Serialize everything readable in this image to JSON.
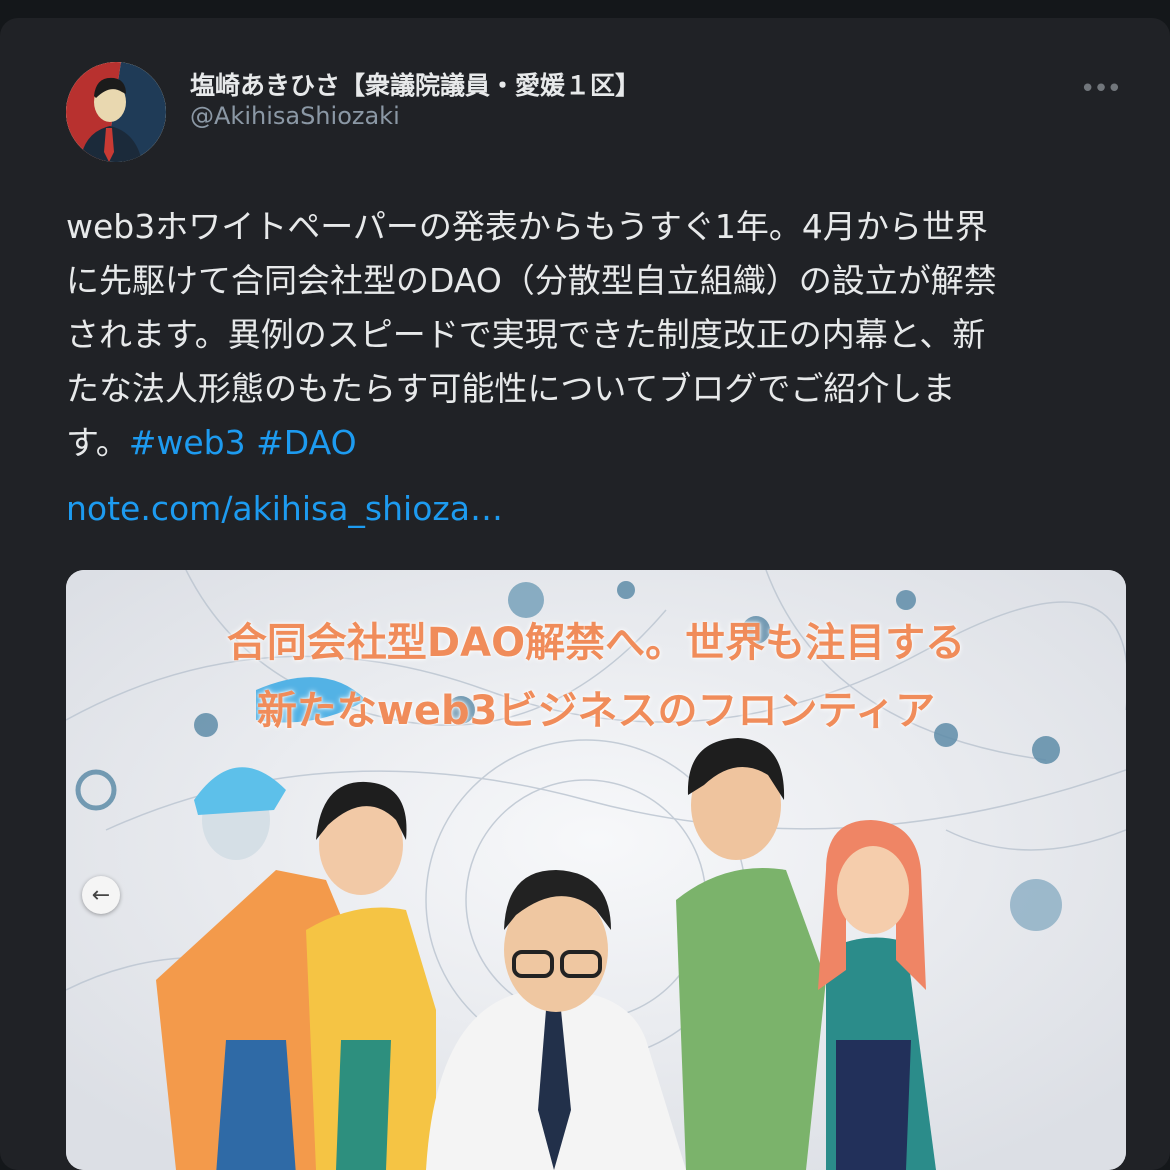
{
  "tweet": {
    "author_name": "塩崎あきひさ【衆議院議員・愛媛１区】",
    "handle": "@AkihisaShiozaki",
    "more_icon": "more-horizontal-icon",
    "text_lines": [
      "web3ホワイトペーパーの発表からもうすぐ1年。4月から世界",
      "に先駆けて合同会社型のDAO（分散型自立組織）の設立が解禁",
      "されます。異例のスピードで実現できた制度改正の内幕と、新",
      "たな法人形態のもたらす可能性についてブログでご紹介しま",
      "す。"
    ],
    "hashtags": [
      "#web3",
      "#DAO"
    ],
    "link": "note.com/akihisa_shioza…"
  },
  "media": {
    "headline_lines": [
      "合同会社型DAO解禁へ。世界も注目する",
      "新たなweb3ビジネスのフロンティア"
    ],
    "prev_icon": "arrow-left-icon",
    "prev_arrow": "←"
  },
  "colors": {
    "background": "#14171a",
    "card": "#202226",
    "text": "#e7e9ea",
    "secondary": "#8b98a5",
    "link": "#1d9bf0",
    "headline": "#f08c5a"
  }
}
